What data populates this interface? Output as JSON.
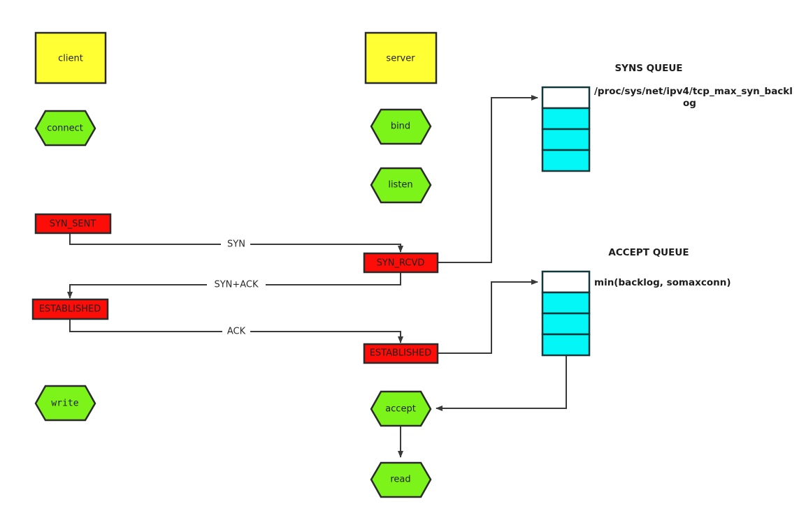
{
  "palette": {
    "process_fill": "#ffff33",
    "action_fill": "#7cf319",
    "state_fill": "#fc0d07",
    "queue_filled": "#04f7f7",
    "queue_empty": "#ffffff",
    "edge": "#3a3a3a",
    "outline": "#2b2b2b"
  },
  "client": {
    "title": "client",
    "connect": "connect",
    "syn_sent": "SYN_SENT",
    "established": "ESTABLISHED",
    "write": "write"
  },
  "server": {
    "title": "server",
    "bind": "bind",
    "listen": "listen",
    "syn_rcvd": "SYN_RCVD",
    "established": "ESTABLISHED",
    "accept": "accept",
    "read": "read"
  },
  "messages": {
    "syn": "SYN",
    "syn_ack": "SYN+ACK",
    "ack": "ACK"
  },
  "syns_queue": {
    "title": "SYNS QUEUE",
    "note_line1": "/proc/sys/net/ipv4/tcp_max_syn_backl",
    "note_line2": "og",
    "cells": [
      "empty",
      "filled",
      "filled",
      "filled"
    ]
  },
  "accept_queue": {
    "title": "ACCEPT QUEUE",
    "note_line1": "min(backlog, somaxconn)",
    "cells": [
      "empty",
      "filled",
      "filled",
      "filled"
    ]
  }
}
